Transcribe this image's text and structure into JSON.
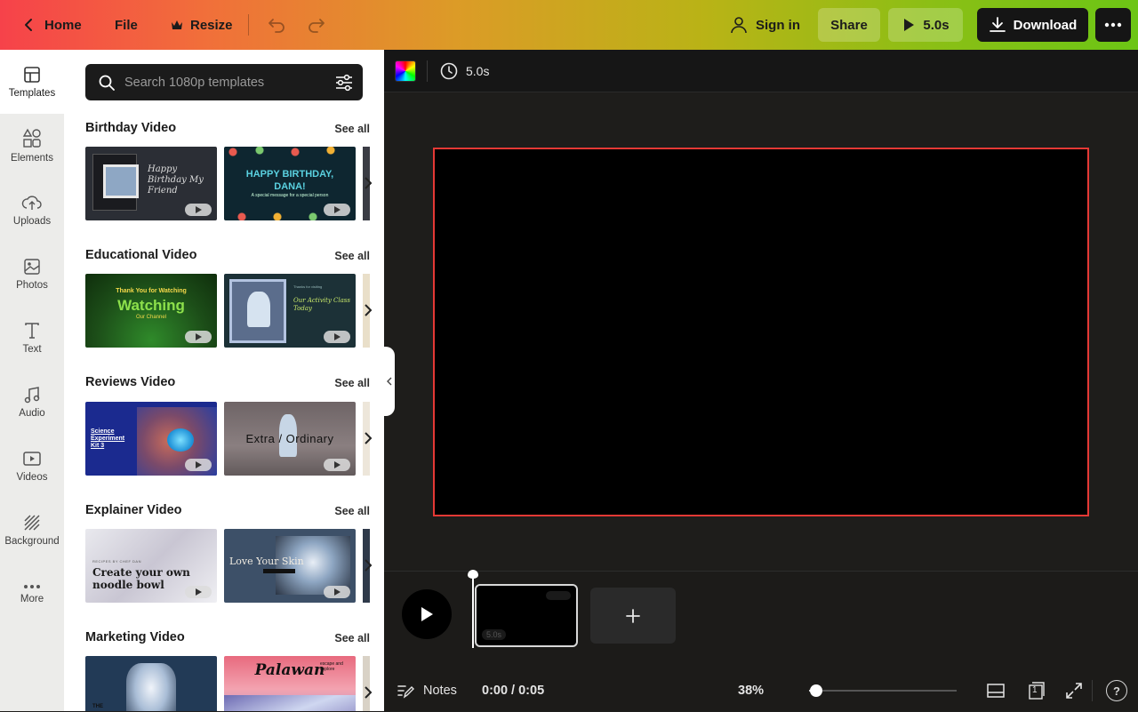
{
  "topbar": {
    "home_label": "Home",
    "file_label": "File",
    "resize_label": "Resize",
    "sign_in_label": "Sign in",
    "share_label": "Share",
    "play_duration_label": "5.0s",
    "download_label": "Download"
  },
  "rail": {
    "items": [
      {
        "label": "Templates",
        "icon": "templates-icon",
        "active": true
      },
      {
        "label": "Elements",
        "icon": "elements-icon"
      },
      {
        "label": "Uploads",
        "icon": "cloud-upload-icon"
      },
      {
        "label": "Photos",
        "icon": "image-icon"
      },
      {
        "label": "Text",
        "icon": "text-t-icon"
      },
      {
        "label": "Audio",
        "icon": "music-note-icon"
      },
      {
        "label": "Videos",
        "icon": "video-play-icon"
      },
      {
        "label": "Background",
        "icon": "background-stripes-icon"
      },
      {
        "label": "More",
        "icon": "more-dots-icon"
      }
    ]
  },
  "panel": {
    "search_placeholder": "Search 1080p templates",
    "see_all_label": "See all",
    "sections": [
      {
        "title": "Birthday Video",
        "thumbs": [
          {
            "text": "Happy Birthday My Friend"
          },
          {
            "text": "HAPPY BIRTHDAY, DANA!",
            "sub": "A special message for a special person"
          }
        ]
      },
      {
        "title": "Educational Video",
        "thumbs": [
          {
            "text": "Thank You for Watching",
            "sub": "Our Channel"
          },
          {
            "text": "Our Activity Class Today",
            "sub": "Thanks for visiting"
          }
        ]
      },
      {
        "title": "Reviews Video",
        "thumbs": [
          {
            "text": "Science Experiment Kit 3"
          },
          {
            "text": "Extra / Ordinary"
          }
        ]
      },
      {
        "title": "Explainer Video",
        "thumbs": [
          {
            "text": "Create your own noodle bowl",
            "sub": "RECIPES BY CHEF DAN"
          },
          {
            "text": "Love Your Skin"
          }
        ]
      },
      {
        "title": "Marketing Video",
        "thumbs": [
          {
            "text": "THE"
          },
          {
            "text": "Palawan",
            "sub": "escape and explore"
          }
        ]
      }
    ]
  },
  "editor": {
    "duration_label": "5.0s",
    "clip_badge": "5.0s",
    "notes_label": "Notes",
    "time_readout": "0:00 / 0:05",
    "zoom_label": "38%",
    "zoom_level": 0.05,
    "page_count": "1",
    "help_label": "?"
  },
  "colors": {
    "canvas_border": "#e53935",
    "topbar_gradient_start": "#f6424a",
    "topbar_gradient_end": "#6cc515"
  }
}
